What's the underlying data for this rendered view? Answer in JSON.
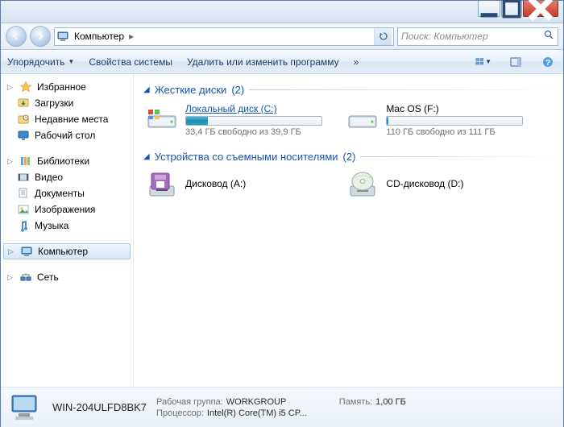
{
  "window": {
    "title": "Компьютер"
  },
  "nav": {
    "breadcrumb": [
      "Компьютер"
    ],
    "search_placeholder": "Поиск: Компьютер"
  },
  "toolbar": {
    "organize": "Упорядочить",
    "system_props": "Свойства системы",
    "uninstall": "Удалить или изменить программу"
  },
  "sidebar": {
    "favorites": {
      "label": "Избранное",
      "items": [
        "Загрузки",
        "Недавние места",
        "Рабочий стол"
      ]
    },
    "libraries": {
      "label": "Библиотеки",
      "items": [
        "Видео",
        "Документы",
        "Изображения",
        "Музыка"
      ]
    },
    "computer": {
      "label": "Компьютер"
    },
    "network": {
      "label": "Сеть"
    }
  },
  "sections": {
    "hdd": {
      "title": "Жесткие диски",
      "count": "(2)"
    },
    "removable": {
      "title": "Устройства со съемными носителями",
      "count": "(2)"
    }
  },
  "drives": {
    "c": {
      "name": "Локальный диск (C:)",
      "free": "33,4 ГБ свободно из 39,9 ГБ",
      "fill_pct": 16
    },
    "f": {
      "name": "Mac OS (F:)",
      "free": "110 ГБ свободно из 111 ГБ",
      "fill_pct": 1
    },
    "a": {
      "name": "Дисковод (A:)"
    },
    "d": {
      "name": "CD-дисковод (D:)"
    }
  },
  "details": {
    "name": "WIN-204ULFD8BK7",
    "workgroup_label": "Рабочая группа:",
    "workgroup": "WORKGROUP",
    "cpu_label": "Процессор:",
    "cpu": "Intel(R) Core(TM) i5 CP...",
    "mem_label": "Память:",
    "mem": "1,00 ГБ"
  }
}
